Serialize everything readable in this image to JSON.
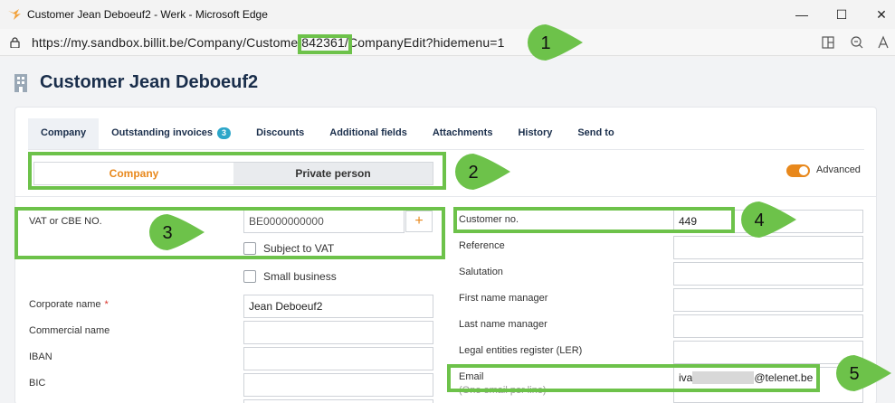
{
  "window": {
    "title": "Customer Jean Deboeuf2 - Werk - Microsoft Edge",
    "minimize": "—",
    "maximize": "☐",
    "close": "✕"
  },
  "address": {
    "url_prefix": "https://my.sandbox.billit.be/Company/Custome",
    "url_id": "/842361/",
    "url_suffix": "CompanyEdit?hidemenu=1"
  },
  "page": {
    "title": "Customer Jean Deboeuf2"
  },
  "tabs": [
    {
      "label": "Company"
    },
    {
      "label": "Outstanding invoices",
      "badge": "3"
    },
    {
      "label": "Discounts"
    },
    {
      "label": "Additional fields"
    },
    {
      "label": "Attachments"
    },
    {
      "label": "History"
    },
    {
      "label": "Send to"
    }
  ],
  "segment": {
    "option1": "Company",
    "option2": "Private person",
    "selected": "Company"
  },
  "advanced": {
    "label": "Advanced",
    "on": true
  },
  "left_form": {
    "vat_label": "VAT or CBE NO.",
    "vat_placeholder": "BE0000000000",
    "plus": "+",
    "subject_vat": "Subject to VAT",
    "small_business": "Small business",
    "corporate_name_label": "Corporate name",
    "required_mark": "*",
    "corporate_name_value": "Jean Deboeuf2",
    "commercial_name_label": "Commercial name",
    "iban_label": "IBAN",
    "bic_label": "BIC"
  },
  "right_form": {
    "customer_no_label": "Customer no.",
    "customer_no_value": "449",
    "reference_label": "Reference",
    "salutation_label": "Salutation",
    "first_name_label": "First name manager",
    "last_name_label": "Last name manager",
    "ler_label": "Legal entities register (LER)",
    "email_label": "Email",
    "email_sub_label": "(One email per line)",
    "email_prefix": "iva",
    "email_domain": "@telenet.be"
  },
  "annotations": [
    "1",
    "2",
    "3",
    "4",
    "5"
  ],
  "colors": {
    "highlight": "#6dc24a",
    "accent": "#e8881c",
    "title": "#1a2e4b",
    "badge": "#2ca6c9"
  }
}
